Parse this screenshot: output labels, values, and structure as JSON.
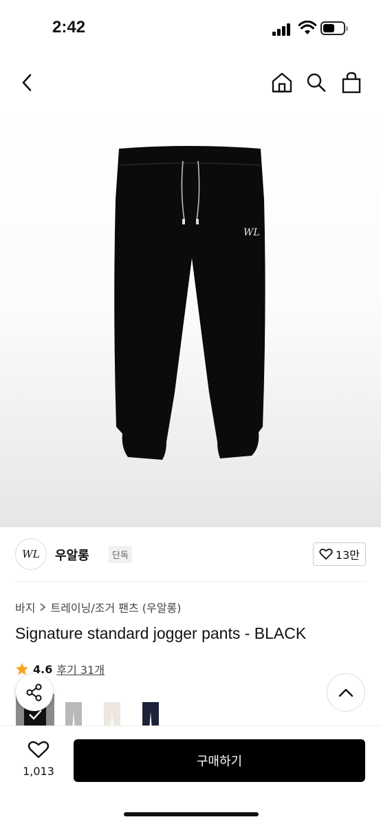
{
  "status": {
    "time": "2:42"
  },
  "nav": {
    "back_icon": "chevron-left-icon",
    "home_icon": "home-icon",
    "search_icon": "search-icon",
    "bag_icon": "bag-icon"
  },
  "brand": {
    "logo_text": "WL",
    "name": "우알롱",
    "badge": "단독",
    "like_count": "13만"
  },
  "breadcrumb": {
    "category": "바지",
    "subcategory": "트레이닝/조거 팬츠 (우알롱)"
  },
  "product": {
    "title": "Signature standard jogger pants - BLACK",
    "rating": "4.6",
    "reviews_label": "후기 31개"
  },
  "swatches": [
    {
      "name": "black",
      "color": "#111111",
      "selected": true
    },
    {
      "name": "gray",
      "color": "#b9b9b9",
      "selected": false
    },
    {
      "name": "ivory",
      "color": "#ece8df",
      "selected": false
    },
    {
      "name": "navy",
      "color": "#1c2238",
      "selected": false
    }
  ],
  "bottom": {
    "wish_count": "1,013",
    "buy_label": "구매하기"
  },
  "colors": {
    "accent": "#000000",
    "star": "#f5a623"
  }
}
